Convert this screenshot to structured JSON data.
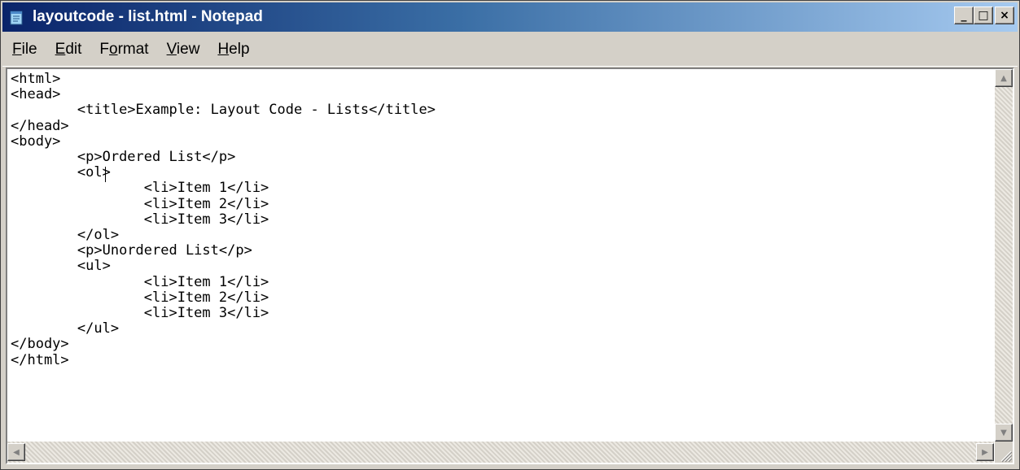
{
  "window": {
    "title": "layoutcode - list.html - Notepad",
    "minimize_label": "_",
    "maximize_label": "□",
    "close_label": "×"
  },
  "menu": {
    "file": {
      "accel": "F",
      "rest": "ile"
    },
    "edit": {
      "accel": "E",
      "rest": "dit"
    },
    "format": {
      "pre": "F",
      "accel": "o",
      "rest": "rmat"
    },
    "view": {
      "accel": "V",
      "rest": "iew"
    },
    "help": {
      "accel": "H",
      "rest": "elp"
    }
  },
  "editor": {
    "content": "<html>\n<head>\n\t<title>Example: Layout Code - Lists</title>\n</head>\n<body>\n\t<p>Ordered List</p>\n\t<ol>\n\t\t<li>Item 1</li>\n\t\t<li>Item 2</li>\n\t\t<li>Item 3</li>\n\t</ol>\n\t<p>Unordered List</p>\n\t<ul>\n\t\t<li>Item 1</li>\n\t\t<li>Item 2</li>\n\t\t<li>Item 3</li>\n\t</ul>\n</body>\n</html>"
  },
  "scrollbars": {
    "up_arrow": "▲",
    "down_arrow": "▼",
    "left_arrow": "◀",
    "right_arrow": "▶"
  },
  "icons": {
    "app": "notepad-icon",
    "grip": "size-grip-icon"
  },
  "colors": {
    "titlebar_start": "#0a246a",
    "titlebar_end": "#a6caf0",
    "chrome": "#d4d0c8"
  }
}
